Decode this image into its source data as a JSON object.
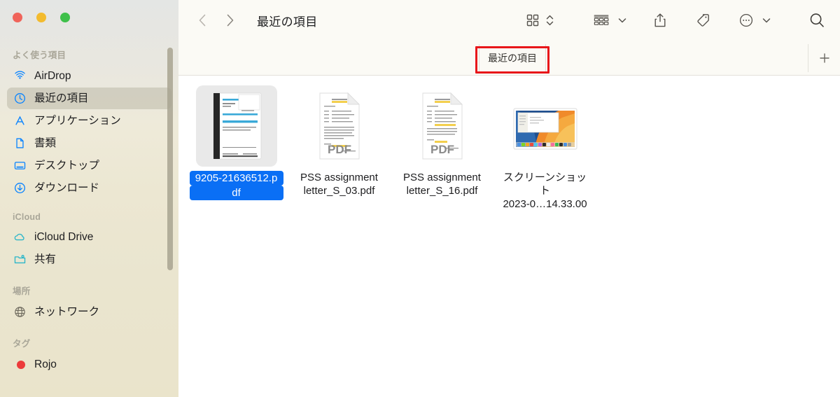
{
  "window": {
    "traffic_lights": [
      {
        "name": "close",
        "color": "#f0645a"
      },
      {
        "name": "minimize",
        "color": "#f3bb2e"
      },
      {
        "name": "zoom",
        "color": "#3fc04a"
      }
    ]
  },
  "sidebar": {
    "sections": [
      {
        "title": "よく使う項目",
        "items": [
          {
            "label": "AirDrop",
            "icon": "airdrop-icon",
            "selected": false
          },
          {
            "label": "最近の項目",
            "icon": "clock-icon",
            "selected": true
          },
          {
            "label": "アプリケーション",
            "icon": "applications-icon",
            "selected": false
          },
          {
            "label": "書類",
            "icon": "document-icon",
            "selected": false
          },
          {
            "label": "デスクトップ",
            "icon": "desktop-icon",
            "selected": false
          },
          {
            "label": "ダウンロード",
            "icon": "downloads-icon",
            "selected": false
          }
        ]
      },
      {
        "title": "iCloud",
        "items": [
          {
            "label": "iCloud Drive",
            "icon": "cloud-icon",
            "selected": false
          },
          {
            "label": "共有",
            "icon": "shared-folder-icon",
            "selected": false
          }
        ]
      },
      {
        "title": "場所",
        "items": [
          {
            "label": "ネットワーク",
            "icon": "network-globe-icon",
            "selected": false
          }
        ]
      },
      {
        "title": "タグ",
        "items": [
          {
            "label": "Rojo",
            "icon": "red-tag-dot",
            "selected": false
          }
        ]
      }
    ],
    "accent_color": "#0a6ff5",
    "selected_row_color": "#b8b396"
  },
  "toolbar": {
    "back_label": "戻る",
    "forward_label": "進む",
    "title": "最近の項目",
    "buttons": [
      {
        "name": "view-mode-icon-grid",
        "label": "表示方法"
      },
      {
        "name": "group-by-icon",
        "label": "グループ"
      },
      {
        "name": "share-icon",
        "label": "共有"
      },
      {
        "name": "tag-icon",
        "label": "タグ"
      },
      {
        "name": "more-options-icon",
        "label": "その他"
      },
      {
        "name": "search-icon",
        "label": "検索"
      }
    ]
  },
  "tabbar": {
    "active_tab": "最近の項目",
    "add_tab_label": "+",
    "highlight_color": "#e8161a"
  },
  "files": [
    {
      "name": "9205-21636512.pdf",
      "name_line1": "9205-21636512.p",
      "name_line2": "df",
      "kind": "pdf-preview",
      "selected": true
    },
    {
      "name": "PSS assignment letter_S_03.pdf",
      "name_line1": "PSS assignment",
      "name_line2": "letter_S_03.pdf",
      "kind": "pdf",
      "badge": "PDF",
      "selected": false
    },
    {
      "name": "PSS assignment letter_S_16.pdf",
      "name_line1": "PSS assignment",
      "name_line2": "letter_S_16.pdf",
      "kind": "pdf",
      "badge": "PDF",
      "selected": false
    },
    {
      "name": "スクリーンショット 2023-0…14.33.00",
      "name_line1": "スクリーンショット",
      "name_line2": "2023-0…14.33.00",
      "kind": "screenshot",
      "selected": false
    }
  ]
}
